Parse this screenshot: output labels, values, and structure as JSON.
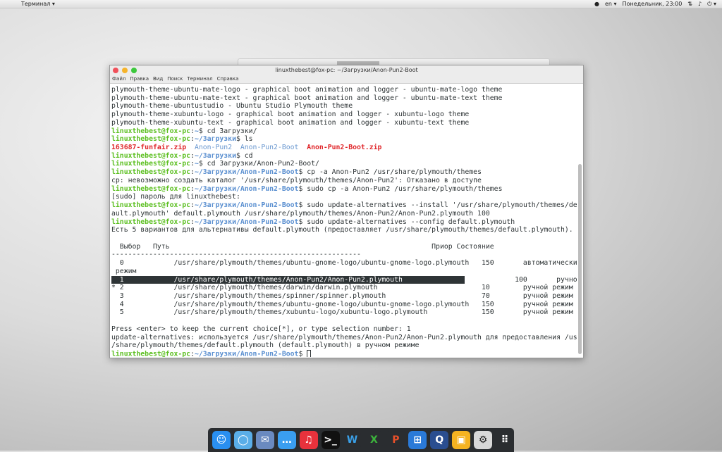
{
  "topbar": {
    "app_menu": "Терминал ▾",
    "lang": "en ▾",
    "datetime": "Понедельник, 23:00"
  },
  "terminal": {
    "title": "linuxthebest@fox-pc: ~/Загрузки/Anon-Pun2-Boot",
    "menu": [
      "Файл",
      "Правка",
      "Вид",
      "Поиск",
      "Терминал",
      "Справка"
    ],
    "lines": [
      [
        {
          "t": "plymouth-theme-ubuntu-mate-logo - graphical boot animation and logger - ubuntu-mate-logo theme"
        }
      ],
      [
        {
          "t": "plymouth-theme-ubuntu-mate-text - graphical boot animation and logger - ubuntu-mate-text theme"
        }
      ],
      [
        {
          "t": "plymouth-theme-ubuntustudio - Ubuntu Studio Plymouth theme"
        }
      ],
      [
        {
          "t": "plymouth-theme-xubuntu-logo - graphical boot animation and logger - xubuntu-logo theme"
        }
      ],
      [
        {
          "t": "plymouth-theme-xubuntu-text - graphical boot animation and logger - xubuntu-text theme"
        }
      ],
      [
        {
          "t": "linuxthebest@fox-pc",
          "c": "g"
        },
        {
          "t": ":"
        },
        {
          "t": "~",
          "c": "b"
        },
        {
          "t": "$ cd Загрузки/"
        }
      ],
      [
        {
          "t": "linuxthebest@fox-pc",
          "c": "g"
        },
        {
          "t": ":"
        },
        {
          "t": "~/Загрузки",
          "c": "b"
        },
        {
          "t": "$ ls"
        }
      ],
      [
        {
          "t": "163687-funfair.zip",
          "c": "r"
        },
        {
          "t": "  "
        },
        {
          "t": "Anon-Pun2",
          "c": "bb"
        },
        {
          "t": "  "
        },
        {
          "t": "Anon-Pun2-Boot",
          "c": "bb"
        },
        {
          "t": "  "
        },
        {
          "t": "Anon-Pun2-Boot.zip",
          "c": "r"
        }
      ],
      [
        {
          "t": "linuxthebest@fox-pc",
          "c": "g"
        },
        {
          "t": ":"
        },
        {
          "t": "~/Загрузки",
          "c": "b"
        },
        {
          "t": "$ cd"
        }
      ],
      [
        {
          "t": "linuxthebest@fox-pc",
          "c": "g"
        },
        {
          "t": ":"
        },
        {
          "t": "~",
          "c": "b"
        },
        {
          "t": "$ cd Загрузки/Anon-Pun2-Boot/"
        }
      ],
      [
        {
          "t": "linuxthebest@fox-pc",
          "c": "g"
        },
        {
          "t": ":"
        },
        {
          "t": "~/Загрузки/Anon-Pun2-Boot",
          "c": "b"
        },
        {
          "t": "$ cp -a Anon-Pun2 /usr/share/plymouth/themes"
        }
      ],
      [
        {
          "t": "cp: невозможно создать каталог '/usr/share/plymouth/themes/Anon-Pun2': Отказано в доступе"
        }
      ],
      [
        {
          "t": "linuxthebest@fox-pc",
          "c": "g"
        },
        {
          "t": ":"
        },
        {
          "t": "~/Загрузки/Anon-Pun2-Boot",
          "c": "b"
        },
        {
          "t": "$ sudo cp -a Anon-Pun2 /usr/share/plymouth/themes"
        }
      ],
      [
        {
          "t": "[sudo] пароль для linuxthebest:"
        }
      ],
      [
        {
          "t": "linuxthebest@fox-pc",
          "c": "g"
        },
        {
          "t": ":"
        },
        {
          "t": "~/Загрузки/Anon-Pun2-Boot",
          "c": "b"
        },
        {
          "t": "$ sudo update-alternatives --install '/usr/share/plymouth/themes/def"
        }
      ],
      [
        {
          "t": "ault.plymouth' default.plymouth /usr/share/plymouth/themes/Anon-Pun2/Anon-Pun2.plymouth 100"
        }
      ],
      [
        {
          "t": "linuxthebest@fox-pc",
          "c": "g"
        },
        {
          "t": ":"
        },
        {
          "t": "~/Загрузки/Anon-Pun2-Boot",
          "c": "b"
        },
        {
          "t": "$ sudo update-alternatives --config default.plymouth"
        }
      ],
      [
        {
          "t": "Есть 5 вариантов для альтернативы default.plymouth (предоставляет /usr/share/plymouth/themes/default.plymouth)."
        }
      ],
      [
        {
          "t": ""
        }
      ],
      [
        {
          "t": "  Выбор   Путь                                                               Приор Состояние"
        }
      ],
      [
        {
          "t": "------------------------------------------------------------"
        }
      ],
      [
        {
          "t": "  0            /usr/share/plymouth/themes/ubuntu-gnome-logo/ubuntu-gnome-logo.plymouth   150       автоматический"
        }
      ],
      [
        {
          "t": " режим"
        }
      ],
      [
        {
          "t": "  1            /usr/share/plymouth/themes/Anon-Pun2/Anon-Pun2.plymouth               ",
          "c": "hl"
        },
        {
          "t": "            100       ручной режим"
        }
      ],
      [
        {
          "t": "* 2            /usr/share/plymouth/themes/darwin/darwin.plymouth                         10        ручной режим"
        }
      ],
      [
        {
          "t": "  3            /usr/share/plymouth/themes/spinner/spinner.plymouth                       70        ручной режим"
        }
      ],
      [
        {
          "t": "  4            /usr/share/plymouth/themes/ubuntu-gnome-logo/ubuntu-gnome-logo.plymouth   150       ручной режим"
        }
      ],
      [
        {
          "t": "  5            /usr/share/plymouth/themes/xubuntu-logo/xubuntu-logo.plymouth             150       ручной режим"
        }
      ],
      [
        {
          "t": ""
        }
      ],
      [
        {
          "t": "Press <enter> to keep the current choice[*], or type selection number: 1"
        }
      ],
      [
        {
          "t": "update-alternatives: используется /usr/share/plymouth/themes/Anon-Pun2/Anon-Pun2.plymouth для предоставления /usr"
        }
      ],
      [
        {
          "t": "/share/plymouth/themes/default.plymouth (default.plymouth) в ручном режиме"
        }
      ],
      [
        {
          "t": "linuxthebest@fox-pc",
          "c": "g"
        },
        {
          "t": ":"
        },
        {
          "t": "~/Загрузки/Anon-Pun2-Boot",
          "c": "b"
        },
        {
          "t": "$ "
        }
      ]
    ]
  },
  "dock": [
    {
      "name": "finder-icon",
      "color": "#2a8ff0",
      "glyph": "☺"
    },
    {
      "name": "chromium-icon",
      "color": "#5aaee8",
      "glyph": "◯"
    },
    {
      "name": "mail-icon",
      "color": "#6a8ac0",
      "glyph": "✉"
    },
    {
      "name": "messages-icon",
      "color": "#3a9ef0",
      "glyph": "…"
    },
    {
      "name": "music-icon",
      "color": "#e8323c",
      "glyph": "♫"
    },
    {
      "name": "terminal-icon",
      "color": "#111111",
      "glyph": ">_"
    },
    {
      "name": "word-icon",
      "color": "#2a2d30",
      "glyph": "W"
    },
    {
      "name": "excel-icon",
      "color": "#2a2d30",
      "glyph": "X"
    },
    {
      "name": "powerpoint-icon",
      "color": "#2a2d30",
      "glyph": "P"
    },
    {
      "name": "system-monitor-icon",
      "color": "#2a7ad8",
      "glyph": "⊞"
    },
    {
      "name": "quicktime-icon",
      "color": "#2a4e90",
      "glyph": "Q"
    },
    {
      "name": "store-icon",
      "color": "#f5b321",
      "glyph": "▣"
    },
    {
      "name": "settings-icon",
      "color": "#d8d8d8",
      "glyph": "⚙"
    },
    {
      "name": "apps-grid-icon",
      "color": "#2a2d30",
      "glyph": "⠿"
    }
  ]
}
